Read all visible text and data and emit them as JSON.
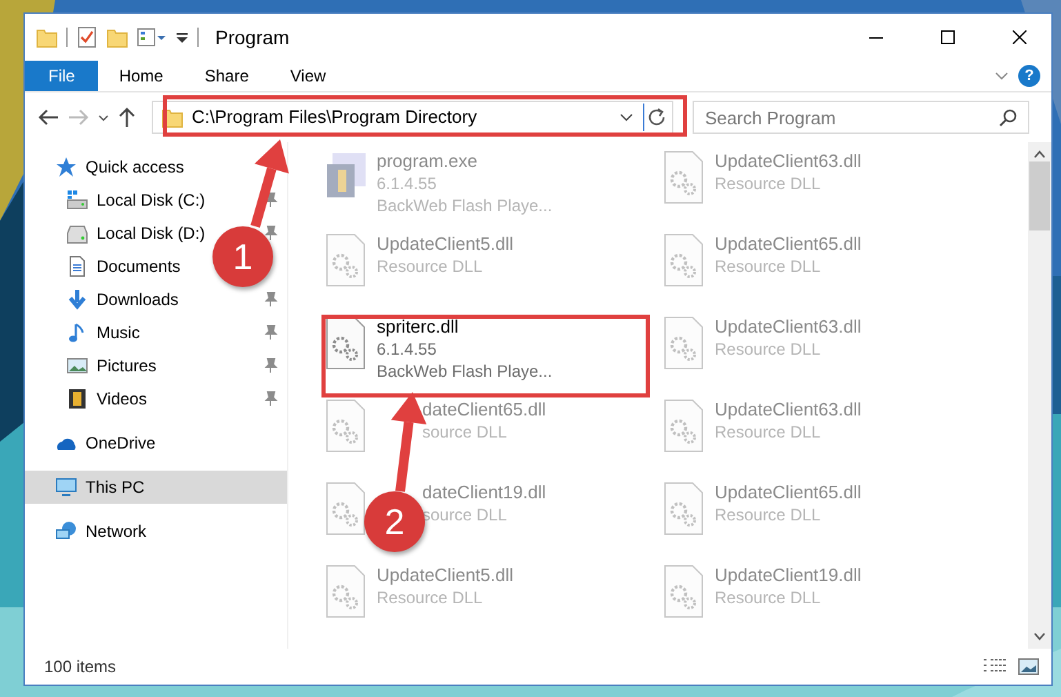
{
  "window": {
    "title": "Program"
  },
  "ribbon": {
    "tabs": [
      {
        "label": "File",
        "kind": "file",
        "selected": false
      },
      {
        "label": "Home",
        "kind": "tab",
        "selected": false
      },
      {
        "label": "Share",
        "kind": "tab",
        "selected": false
      },
      {
        "label": "View",
        "kind": "tab",
        "selected": false
      }
    ],
    "help": "?"
  },
  "address_bar": {
    "path": "C:\\Program Files\\Program Directory"
  },
  "search": {
    "placeholder": "Search Program"
  },
  "sidebar": {
    "items": [
      {
        "label": "Quick access",
        "selected": false,
        "children": [
          {
            "label": "Local Disk (C:)",
            "selected": false,
            "pinned": true
          },
          {
            "label": "Local Disk (D:)",
            "selected": false,
            "pinned": true
          },
          {
            "label": "Documents",
            "selected": false,
            "pinned": false
          },
          {
            "label": "Downloads",
            "selected": false,
            "pinned": true
          },
          {
            "label": "Music",
            "selected": false,
            "pinned": true
          },
          {
            "label": "Pictures",
            "selected": false,
            "pinned": true
          },
          {
            "label": "Videos",
            "selected": false,
            "pinned": true
          }
        ]
      },
      {
        "label": "OneDrive",
        "selected": false
      },
      {
        "label": "This PC",
        "selected": true
      },
      {
        "label": "Network",
        "selected": false
      }
    ]
  },
  "files": [
    {
      "name": "program.exe",
      "kind": "exe",
      "blurred": true,
      "details": [
        "6.1.4.55",
        "BackWeb Flash Playe..."
      ]
    },
    {
      "name": "UpdateClient63.dll",
      "kind": "dll",
      "blurred": true,
      "details": [
        "Resource DLL"
      ]
    },
    {
      "name": "UpdateClient5.dll",
      "kind": "dll",
      "blurred": true,
      "details": [
        "Resource DLL"
      ]
    },
    {
      "name": "UpdateClient65.dll",
      "kind": "dll",
      "blurred": true,
      "details": [
        "Resource DLL"
      ]
    },
    {
      "name": "spriterc.dll",
      "kind": "dll",
      "blurred": false,
      "details": [
        "6.1.4.55",
        "BackWeb Flash Playe..."
      ]
    },
    {
      "name": "UpdateClient63.dll",
      "kind": "dll",
      "blurred": true,
      "details": [
        "Resource DLL"
      ]
    },
    {
      "name": "dateClient65.dll",
      "kind": "dll",
      "blurred": true,
      "covered": true,
      "details": [
        "source DLL"
      ]
    },
    {
      "name": "UpdateClient63.dll",
      "kind": "dll",
      "blurred": true,
      "details": [
        "Resource DLL"
      ]
    },
    {
      "name": "dateClient19.dll",
      "kind": "dll",
      "blurred": true,
      "covered": true,
      "details": [
        "source DLL"
      ]
    },
    {
      "name": "UpdateClient65.dll",
      "kind": "dll",
      "blurred": true,
      "details": [
        "Resource DLL"
      ]
    },
    {
      "name": "UpdateClient5.dll",
      "kind": "dll",
      "blurred": true,
      "details": [
        "Resource DLL"
      ]
    },
    {
      "name": "UpdateClient19.dll",
      "kind": "dll",
      "blurred": true,
      "details": [
        "Resource DLL"
      ]
    }
  ],
  "status_bar": {
    "text": "100 items"
  },
  "callouts": [
    {
      "number": "1"
    },
    {
      "number": "2"
    }
  ]
}
